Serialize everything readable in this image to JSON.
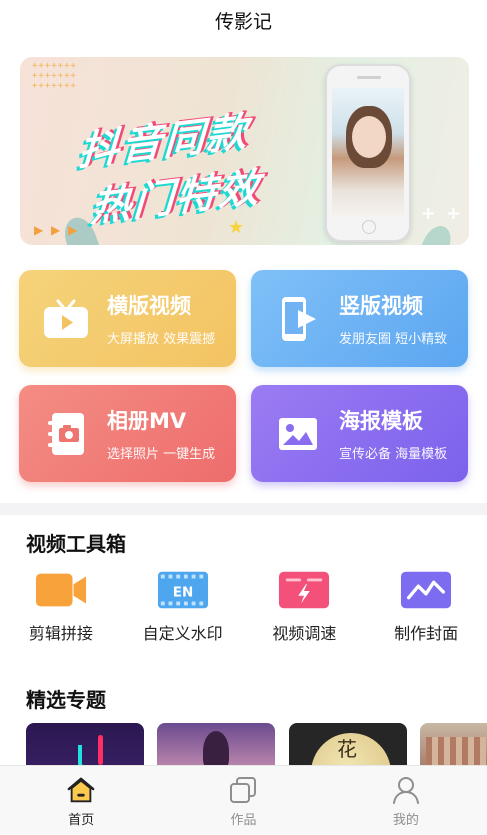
{
  "app": {
    "title": "传影记"
  },
  "banner": {
    "line1": "抖音同款",
    "line2": "热门特效"
  },
  "features": [
    {
      "title": "横版视频",
      "subtitle": "大屏播放 效果震撼",
      "icon": "tv-play-icon",
      "color": "#f3c362"
    },
    {
      "title": "竖版视频",
      "subtitle": "发朋友圈 短小精致",
      "icon": "phone-play-icon",
      "color": "#5ca6f1"
    },
    {
      "title": "相册MV",
      "subtitle": "选择照片 一键生成",
      "icon": "photo-album-icon",
      "color": "#ee6d6c"
    },
    {
      "title": "海报模板",
      "subtitle": "宣传必备 海量模板",
      "icon": "image-icon",
      "color": "#7c61ec"
    }
  ],
  "toolbox": {
    "title": "视频工具箱",
    "items": [
      {
        "label": "剪辑拼接",
        "icon": "video-camera-icon"
      },
      {
        "label": "自定义水印",
        "icon": "watermark-icon"
      },
      {
        "label": "视频调速",
        "icon": "speed-icon"
      },
      {
        "label": "制作封面",
        "icon": "cover-chart-icon"
      }
    ]
  },
  "topics": {
    "title": "精选专题",
    "items": [
      {
        "icon": "tiktok-style-thumbnail"
      },
      {
        "icon": "purple-portrait-thumbnail"
      },
      {
        "icon": "moon-thumbnail",
        "text": "花"
      },
      {
        "icon": "architecture-thumbnail"
      }
    ]
  },
  "tabbar": [
    {
      "label": "首页",
      "icon": "home-icon",
      "active": true
    },
    {
      "label": "作品",
      "icon": "works-icon",
      "active": false
    },
    {
      "label": "我的",
      "icon": "user-icon",
      "active": false
    }
  ]
}
